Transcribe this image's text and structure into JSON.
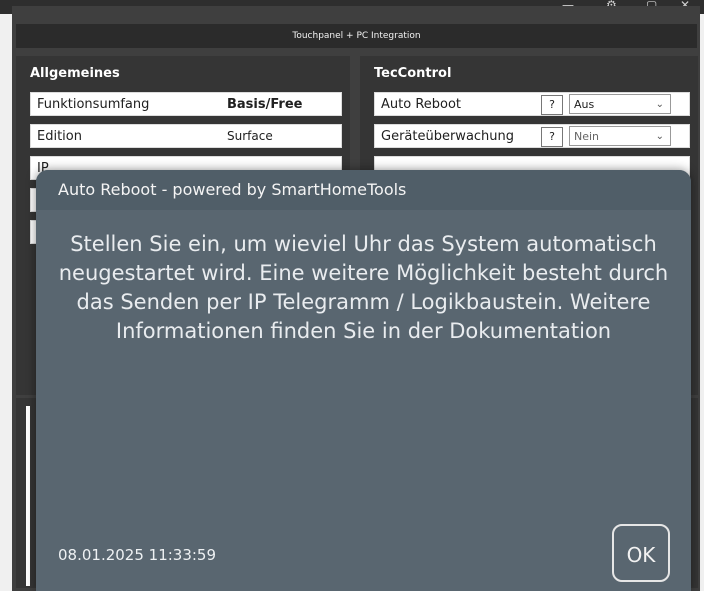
{
  "window": {
    "title": "Touchpanel + PC Integration",
    "controls": [
      "minimize-icon",
      "settings-icon",
      "maximize-icon",
      "close-icon"
    ]
  },
  "allgemeines": {
    "title": "Allgemeines",
    "rows": [
      {
        "label": "Funktionsumfang",
        "value": "Basis/Free"
      },
      {
        "label": "Edition",
        "value": "Surface"
      },
      {
        "label": "IP",
        "value": ""
      }
    ]
  },
  "teccontrol": {
    "title": "TecControl",
    "rows": [
      {
        "label": "Auto Reboot",
        "help": "?",
        "select": "Aus"
      },
      {
        "label": "Geräteüberwachung",
        "help": "?",
        "select": "Nein"
      }
    ]
  },
  "dialog": {
    "title": "Auto Reboot - powered by SmartHomeTools",
    "message": "Stellen Sie ein, um wieviel Uhr das System automatisch neugestartet wird. Eine weitere Möglichkeit besteht durch das Senden per IP Telegramm / Logikbaustein. Weitere Informationen finden Sie in der Dokumentation",
    "timestamp": "08.01.2025 11:33:59",
    "ok_label": "OK"
  },
  "colors": {
    "dialog_bg": "#596670",
    "panel_bg": "#353535",
    "titlebar_bg": "#2b2b2b"
  }
}
